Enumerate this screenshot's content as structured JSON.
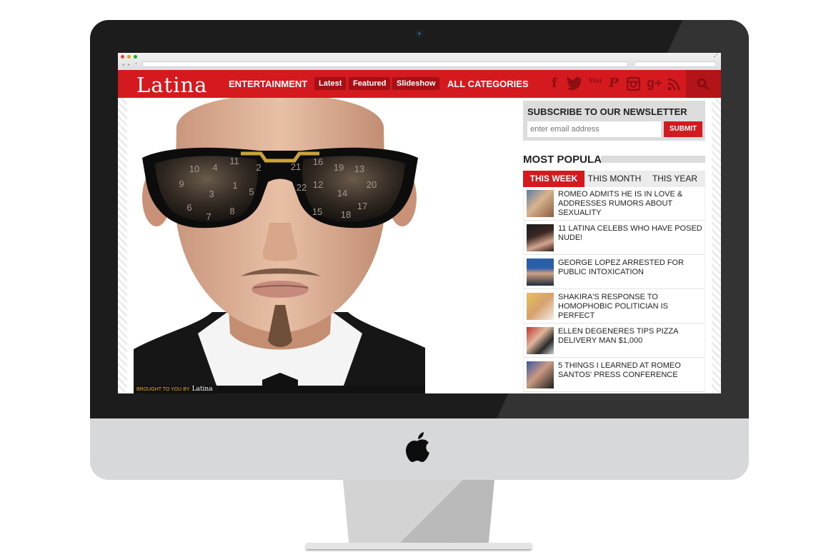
{
  "browser": {
    "url": "",
    "search": "",
    "traffic_lights": [
      "#e0443e",
      "#dea123",
      "#1aab29"
    ]
  },
  "site": {
    "logo": "Latina",
    "nav": {
      "entertainment": "ENTERTAINMENT",
      "pills": [
        "Latest",
        "Featured",
        "Slideshow"
      ],
      "all_categories": "ALL CATEGORIES"
    },
    "social_icons": [
      "facebook-icon",
      "twitter-icon",
      "youtube-icon",
      "pinterest-icon",
      "instagram-icon",
      "google-plus-icon",
      "rss-icon"
    ],
    "social_glyphs": [
      "f",
      "t",
      "You",
      "P",
      "◎",
      "g+",
      "≋"
    ],
    "search_icon": "search-icon",
    "accent": "#d4191f"
  },
  "hero": {
    "credit_prefix": "BROUGHT TO YOU BY",
    "credit_logo": "Latina",
    "lens_left": [
      "10",
      "4",
      "11",
      "2",
      "9",
      "3",
      "1",
      "5",
      "6",
      "7",
      "8"
    ],
    "lens_right": [
      "21",
      "16",
      "19",
      "13",
      "22",
      "12",
      "14",
      "20",
      "15",
      "18",
      "17"
    ]
  },
  "sidebar": {
    "newsletter": {
      "title": "SUBSCRIBE TO OUR NEWSLETTER",
      "placeholder": "enter email address",
      "button": "SUBMIT"
    },
    "most_popular": {
      "title": "MOST POPULAR",
      "tabs": [
        "THIS WEEK",
        "THIS MONTH",
        "THIS YEAR"
      ],
      "active_tab": "THIS WEEK",
      "items": [
        "ROMEO ADMITS HE IS IN LOVE & ADDRESSES RUMORS ABOUT SEXUALITY",
        "11 LATINA CELEBS WHO HAVE POSED NUDE!",
        "GEORGE LOPEZ ARRESTED FOR PUBLIC INTOXICATION",
        "SHAKIRA'S RESPONSE TO HOMOPHOBIC POLITICIAN IS PERFECT",
        "ELLEN DEGENERES TIPS PIZZA DELIVERY MAN $1,000",
        "5 THINGS I LEARNED AT ROMEO SANTOS' PRESS CONFERENCE"
      ]
    }
  }
}
